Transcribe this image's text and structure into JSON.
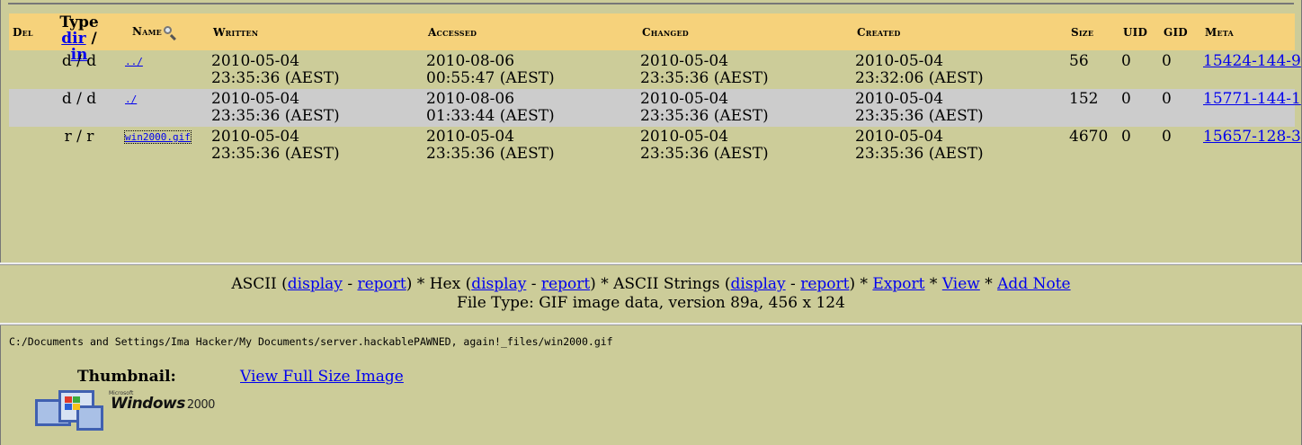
{
  "file_list": {
    "headers": {
      "del": "Del",
      "type": "Type",
      "dir_link": "dir",
      "sep": "/",
      "in_link": "in",
      "name": "Name",
      "written": "Written",
      "accessed": "Accessed",
      "changed": "Changed",
      "created": "Created",
      "size": "Size",
      "uid": "UID",
      "gid": "GID",
      "meta": "Meta"
    },
    "rows": [
      {
        "type": "d / d",
        "name": "../",
        "written": [
          "2010-05-04",
          "23:35:36 (AEST)"
        ],
        "accessed": [
          "2010-08-06",
          "00:55:47 (AEST)"
        ],
        "changed": [
          "2010-05-04",
          "23:35:36 (AEST)"
        ],
        "created": [
          "2010-05-04",
          "23:32:06 (AEST)"
        ],
        "size": "56",
        "uid": "0",
        "gid": "0",
        "meta": "15424-144-9"
      },
      {
        "type": "d / d",
        "name": "./",
        "written": [
          "2010-05-04",
          "23:35:36 (AEST)"
        ],
        "accessed": [
          "2010-08-06",
          "01:33:44 (AEST)"
        ],
        "changed": [
          "2010-05-04",
          "23:35:36 (AEST)"
        ],
        "created": [
          "2010-05-04",
          "23:35:36 (AEST)"
        ],
        "size": "152",
        "uid": "0",
        "gid": "0",
        "meta": "15771-144-1"
      },
      {
        "type": "r / r",
        "name": "win2000.gif",
        "written": [
          "2010-05-04",
          "23:35:36 (AEST)"
        ],
        "accessed": [
          "2010-05-04",
          "23:35:36 (AEST)"
        ],
        "changed": [
          "2010-05-04",
          "23:35:36 (AEST)"
        ],
        "created": [
          "2010-05-04",
          "23:35:36 (AEST)"
        ],
        "size": "4670",
        "uid": "0",
        "gid": "0",
        "meta": "15657-128-3"
      }
    ]
  },
  "menu": {
    "ascii": "ASCII",
    "hex": "Hex",
    "ascii_strings": "ASCII Strings",
    "display": "display",
    "report": "report",
    "dash": "-",
    "open_paren": "(",
    "close_paren": ")",
    "star": "*",
    "export": "Export",
    "view": "View",
    "add_note": "Add Note",
    "file_type": "File Type: GIF image data, version 89a, 456 x 124"
  },
  "content": {
    "path": "C:/Documents and Settings/Ima Hacker/My Documents/server.hackablePAWNED, again!_files/win2000.gif",
    "thumbnail_label": "Thumbnail:",
    "full_size_link": "View Full Size Image",
    "logo_text": "Windows",
    "logo_year": "2000",
    "logo_microsoft": "Microsoft"
  },
  "colors": {
    "background": "#cccc99",
    "header_bg": "#f6d27b",
    "alt_row_bg": "#cccccc",
    "link": "#0000ee"
  },
  "icons": {
    "name_search": "magnifier-icon",
    "thumbnail": "windows-2000-logo"
  }
}
